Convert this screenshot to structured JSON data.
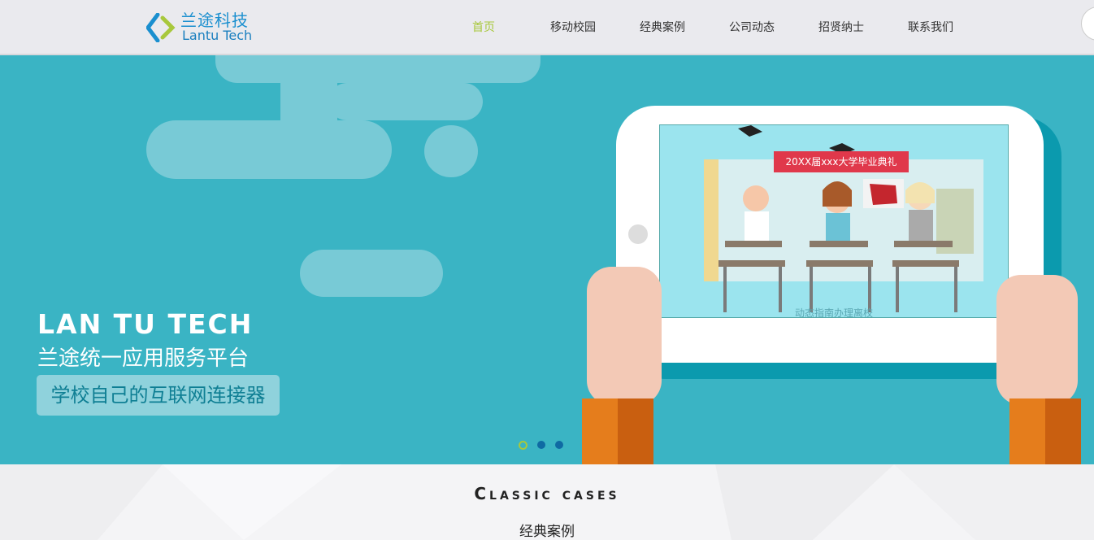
{
  "header": {
    "logo_cn": "兰途科技",
    "logo_en": "Lantu Tech",
    "nav": [
      {
        "label": "首页",
        "active": true
      },
      {
        "label": "移动校园",
        "active": false
      },
      {
        "label": "经典案例",
        "active": false
      },
      {
        "label": "公司动态",
        "active": false
      },
      {
        "label": "招贤纳士",
        "active": false
      },
      {
        "label": "联系我们",
        "active": false
      }
    ]
  },
  "banner": {
    "title": "LAN TU TECH",
    "subtitle": "兰途统一应用服务平台",
    "tag": "学校自己的互联网连接器",
    "screen_ribbon": "20XX届xxx大学毕业典礼",
    "screen_caption": "动态指南办理离校",
    "slides": 3,
    "active_slide": 0
  },
  "cases": {
    "title": "Classic cases",
    "subtitle": "经典案例"
  },
  "colors": {
    "banner_bg": "#3ab4c4",
    "accent": "#a8c83c",
    "dot": "#0f6aa3"
  }
}
